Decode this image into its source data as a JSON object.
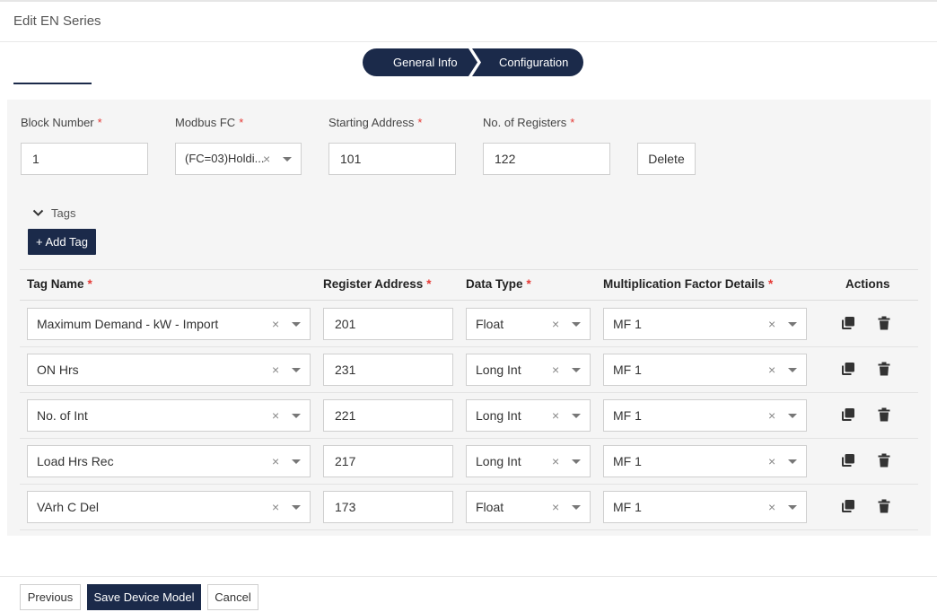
{
  "header": {
    "title": "Edit EN Series"
  },
  "stepper": {
    "step1": "General Info",
    "step2": "Configuration"
  },
  "block": {
    "block_number_label": "Block Number",
    "modbus_fc_label": "Modbus FC",
    "starting_address_label": "Starting Address",
    "num_registers_label": "No. of Registers",
    "block_number": "1",
    "modbus_fc": "(FC=03)Holdi...",
    "starting_address": "101",
    "num_registers": "122",
    "delete_label": "Delete"
  },
  "tags_section": {
    "label": "Tags",
    "add_label": "+ Add Tag"
  },
  "table": {
    "headers": {
      "tag_name": "Tag Name",
      "register_address": "Register Address",
      "data_type": "Data Type",
      "mf_details": "Multiplication Factor Details",
      "actions": "Actions"
    },
    "rows": [
      {
        "tag_name": "Maximum Demand - kW - Import",
        "register_address": "201",
        "data_type": "Float",
        "mf": "MF 1"
      },
      {
        "tag_name": "ON Hrs",
        "register_address": "231",
        "data_type": "Long Int",
        "mf": "MF 1"
      },
      {
        "tag_name": "No. of Int",
        "register_address": "221",
        "data_type": "Long Int",
        "mf": "MF 1"
      },
      {
        "tag_name": "Load Hrs Rec",
        "register_address": "217",
        "data_type": "Long Int",
        "mf": "MF 1"
      },
      {
        "tag_name": "VArh C Del",
        "register_address": "173",
        "data_type": "Float",
        "mf": "MF 1"
      }
    ]
  },
  "icons": {
    "required": "*",
    "clear": "×",
    "copy": "copy-icon",
    "delete": "trash-icon",
    "collapse": "chevron-down-icon"
  },
  "footer": {
    "previous": "Previous",
    "save": "Save Device Model",
    "cancel": "Cancel"
  },
  "colors": {
    "primary": "#1b2a4a",
    "required": "#e53935",
    "panel_bg": "#f5f5f5"
  }
}
